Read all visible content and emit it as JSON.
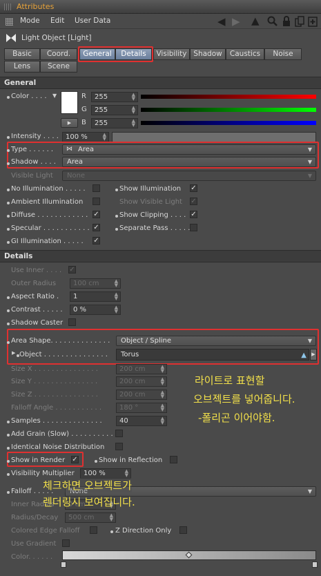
{
  "window": {
    "title": "Attributes"
  },
  "menu": {
    "items": [
      "Mode",
      "Edit",
      "User Data"
    ]
  },
  "object": {
    "title": "Light Object [Light]"
  },
  "tabs": {
    "row1": [
      "Basic",
      "Coord.",
      "General",
      "Details",
      "Visibility",
      "Shadow",
      "Caustics",
      "Noise"
    ],
    "row2": [
      "Lens",
      "Scene"
    ],
    "selected": [
      "General",
      "Details"
    ]
  },
  "general": {
    "header": "General",
    "color": {
      "label": "Color . . . .",
      "r_label": "R",
      "g_label": "G",
      "b_label": "B",
      "r": "255",
      "g": "255",
      "b": "255",
      "swatch": "#ffffff"
    },
    "intensity": {
      "label": "Intensity . . . .",
      "value": "100 %",
      "fill": 1.0
    },
    "type": {
      "label": "Type . . . . . .",
      "value": "Area"
    },
    "shadow": {
      "label": "Shadow . . . .",
      "value": "Area"
    },
    "visible_light": {
      "label": "Visible Light",
      "value": "None"
    },
    "no_illum": "No Illumination . . . . .",
    "show_illum": "Show Illumination",
    "ambient": "Ambient Illumination",
    "show_visible": "Show Visible Light",
    "diffuse": "Diffuse . . . . . . . . . . . .",
    "show_clipping": "Show Clipping . . . .",
    "specular": "Specular . . . . . . . . . . .",
    "separate": "Separate Pass . . . . .",
    "gi": "GI Illumination . . . . ."
  },
  "details": {
    "header": "Details",
    "use_inner": "Use Inner . . . .",
    "outer_radius": {
      "label": "Outer Radius",
      "value": "100 cm"
    },
    "aspect": {
      "label": "Aspect Ratio  .",
      "value": "1"
    },
    "contrast": {
      "label": "Contrast . . . . .",
      "value": "0 %"
    },
    "shadow_caster": "Shadow Caster",
    "area_shape": {
      "label": "Area Shape. . . . . . . . . . . . . .",
      "value": "Object / Spline"
    },
    "object": {
      "label": "Object . . . . . . . . . . . . . . .",
      "value": "Torus"
    },
    "size_x": {
      "label": "Size X . . . . . . . . . . . . . . .",
      "value": "200 cm"
    },
    "size_y": {
      "label": "Size Y . . . . . . . . . . . . . . .",
      "value": "200 cm"
    },
    "size_z": {
      "label": "Size Z . . . . . . . . . . . . . . .",
      "value": "200 cm"
    },
    "falloff_angle": {
      "label": "Falloff Angle . . . . . . . . . . .",
      "value": "180 °"
    },
    "samples": {
      "label": "Samples . . . . . . . . . . . . . .",
      "value": "40"
    },
    "add_grain": "Add Grain (Slow) . . . . . . . . . .",
    "identical_noise": "Identical Noise Distribution",
    "show_in_render": "Show in Render",
    "show_in_reflection": "Show in Reflection",
    "visibility_mult": {
      "label": "Visibility Multiplier",
      "value": "100 %"
    },
    "falloff": {
      "label": "Falloff . . . . .",
      "value": "None"
    },
    "inner_radius": {
      "label": "Inner Radius",
      "value": "0 cm"
    },
    "radius_decay": {
      "label": "Radius/Decay",
      "value": "500 cm"
    },
    "colored_edge": "Colored Edge Falloff",
    "z_direction": "Z Direction Only",
    "use_gradient": "Use Gradient",
    "color_grad": "Color. . . . . ."
  },
  "annotations": {
    "object_note": [
      "라이트로 표현할",
      "오브젝트를 넣어줍니다.",
      "-폴리곤 이어야함."
    ],
    "render_note": [
      "체크하면 오브젝트가",
      "렌더링시 보여집니다."
    ]
  },
  "colors": {
    "accent": "#e8a33a",
    "highlight": "#e03030",
    "annotation": "#f2e04a"
  }
}
